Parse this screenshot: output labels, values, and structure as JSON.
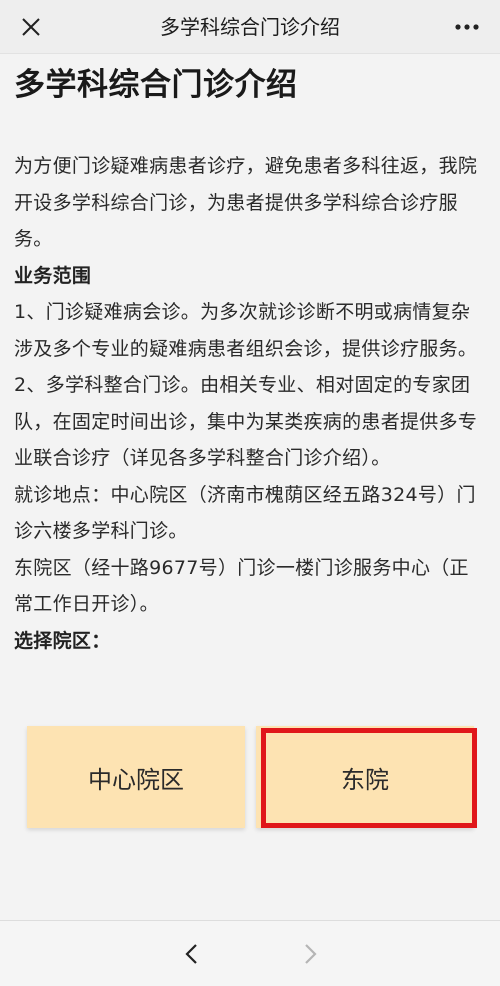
{
  "topbar": {
    "title": "多学科综合门诊介绍",
    "close_icon": "close-icon",
    "more_icon": "more-horizontal-icon"
  },
  "article": {
    "title": "多学科综合门诊介绍",
    "intro": "为方便门诊疑难病患者诊疗，避免患者多科往返，我院开设多学科综合门诊，为患者提供多学科综合诊疗服务。",
    "scope_heading": "业务范围",
    "item1": "1、门诊疑难病会诊。为多次就诊诊断不明或病情复杂涉及多个专业的疑难病患者组织会诊，提供诊疗服务。",
    "item2": "2、多学科整合门诊。由相关专业、相对固定的专家团队，在固定时间出诊，集中为某类疾病的患者提供多专业联合诊疗（详见各多学科整合门诊介绍）。",
    "location_main": "就诊地点：中心院区（济南市槐荫区经五路324号）门诊六楼多学科门诊。",
    "location_east": "东院区（经十路9677号）门诊一楼门诊服务中心（正常工作日开诊）。",
    "choose_label": "选择院区："
  },
  "campus": {
    "center_label": "中心院区",
    "east_label": "东院"
  },
  "colors": {
    "button_bg": "#fde3b2",
    "highlight": "#e0171a"
  },
  "bottombar": {
    "back_icon": "chevron-left-icon",
    "forward_icon": "chevron-right-icon"
  }
}
